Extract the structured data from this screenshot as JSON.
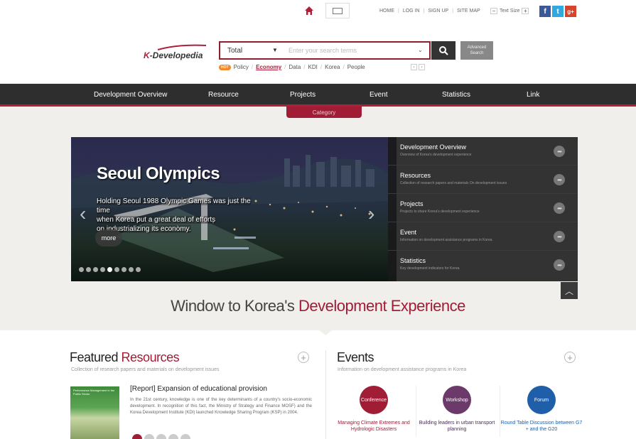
{
  "utility": {
    "links": [
      "HOME",
      "LOG IN",
      "SIGN UP",
      "SITE MAP"
    ],
    "text_size_label": "Text Size",
    "text_size_inc": "+",
    "social": [
      {
        "icon": "facebook-icon",
        "glyph": "f",
        "color": "#3b5998"
      },
      {
        "icon": "twitter-icon",
        "glyph": "t",
        "color": "#2fa9e0"
      },
      {
        "icon": "google-plus-icon",
        "glyph": "g+",
        "color": "#d6442d"
      }
    ]
  },
  "header": {
    "logo_k": "K",
    "logo_rest": "-Developedia",
    "search_scope": "Total",
    "search_placeholder": "Enter your search terms",
    "advanced_line1": "Advanced",
    "advanced_line2": "Search",
    "hot_badge": "HOT",
    "hot_keywords": [
      "Policy",
      "Economy",
      "Data",
      "KDI",
      "Korea",
      "People"
    ],
    "hot_active": "Economy",
    "hot_prev": "‹",
    "hot_next": "›"
  },
  "nav": {
    "items": [
      "Development Overview",
      "Resource",
      "Projects",
      "Event",
      "Statistics",
      "Link"
    ],
    "category": "Category"
  },
  "hero": {
    "title": "Seoul Olympics",
    "desc_lines": [
      "Holding Seoul 1988 Olympic Games was just the time",
      "when Korea put a great deal of efforts",
      "on industrializing its economy."
    ],
    "more": "more",
    "prev_glyph": "‹",
    "next_glyph": "›",
    "panel": [
      {
        "title": "Development Overview",
        "desc": "Overview of Korea's development experience"
      },
      {
        "title": "Resources",
        "desc": "Collection of research papers and materials On development issues"
      },
      {
        "title": "Projects",
        "desc": "Projects to share Korea's development experience"
      },
      {
        "title": "Event",
        "desc": "Information on development assistance programs in Korea"
      },
      {
        "title": "Statistics",
        "desc": "Key development indicators for Korea"
      }
    ],
    "panel_more_glyph": "•••",
    "slide_count": 9,
    "active_slide": 5
  },
  "tagline": {
    "prefix": "Window to Korea's ",
    "highlight": "Development Experience"
  },
  "featured": {
    "title_a": "Featured ",
    "title_b": "Resources",
    "subtitle": "Collection of research papers and materials on development issues",
    "item_title": "[Report] Expansion of educational provision",
    "item_body": "In the 21st century, knowledge is one of the key determinants of a country's socio-economic development. In recognition of this fact, the Ministry of Strategy and Finance MOSF) and the Korea Development Institute (KDI) launched Knowledge Sharing Program (KSP) in 2004.",
    "book_caption": "Performance Management in the Public Sector",
    "pages": 5,
    "active_page": 1
  },
  "events": {
    "title": "Events",
    "subtitle": "Information on development assistance programs in Korea",
    "items": [
      {
        "type": "Conference",
        "label": "Managing Climate Extremes and Hydrologic Disasters",
        "color": "#a11c35",
        "label_color": "#a11c35"
      },
      {
        "type": "Workshop",
        "label": "Building leaders in urban transport planning",
        "color": "#6b3a6b",
        "label_color": "#4a2a5a"
      },
      {
        "type": "Forum",
        "label": "Round Table Discussion between G7 + and the G20",
        "color": "#1f5ea8",
        "label_color": "#1f5ea8"
      }
    ]
  },
  "plus_glyph": "+",
  "up_glyph": "︿"
}
